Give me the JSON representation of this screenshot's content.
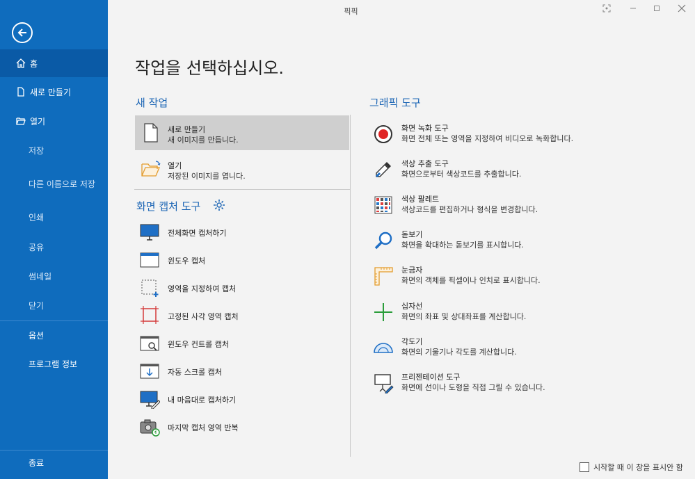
{
  "app": {
    "title": "픽픽"
  },
  "sidebar": {
    "items": [
      {
        "label": "홈"
      },
      {
        "label": "새로 만들기"
      },
      {
        "label": "열기"
      },
      {
        "label": "저장"
      },
      {
        "label": "다른 이름으로 저장"
      },
      {
        "label": "인쇄"
      },
      {
        "label": "공유"
      },
      {
        "label": "썸네일"
      },
      {
        "label": "닫기"
      },
      {
        "label": "옵션"
      },
      {
        "label": "프로그램 정보"
      },
      {
        "label": "종료"
      }
    ]
  },
  "main": {
    "heading": "작업을 선택하십시오.",
    "new_task": {
      "title": "새 작업",
      "items": [
        {
          "title": "새로 만들기",
          "desc": "새 이미지를 만듭니다."
        },
        {
          "title": "열기",
          "desc": "저장된 이미지를 엽니다."
        }
      ]
    },
    "capture": {
      "title": "화면 캡처 도구",
      "items": [
        {
          "label": "전체화면 캡처하기"
        },
        {
          "label": "윈도우 캡처"
        },
        {
          "label": "영역을 지정하여 캡처"
        },
        {
          "label": "고정된 사각 영역 캡처"
        },
        {
          "label": "윈도우 컨트롤 캡처"
        },
        {
          "label": "자동 스크롤 캡처"
        },
        {
          "label": "내 마음대로 캡처하기"
        },
        {
          "label": "마지막 캡처 영역 반복"
        }
      ]
    },
    "graphic": {
      "title": "그래픽 도구",
      "items": [
        {
          "title": "화면 녹화 도구",
          "desc": "화면 전체 또는 영역을 지정하여 비디오로 녹화합니다."
        },
        {
          "title": "색상 추출 도구",
          "desc": "화면으로부터 색상코드를 추출합니다."
        },
        {
          "title": "색상 팔레트",
          "desc": "색상코드를 편집하거나 형식을 변경합니다."
        },
        {
          "title": "돋보기",
          "desc": "화면을 확대하는 돋보기를 표시합니다."
        },
        {
          "title": "눈금자",
          "desc": "화면의 객체를 픽셀이나 인치로 표시합니다."
        },
        {
          "title": "십자선",
          "desc": "화면의 좌표 및 상대좌표를 계산합니다."
        },
        {
          "title": "각도기",
          "desc": "화면의 기울기나 각도를 계산합니다."
        },
        {
          "title": "프리젠테이션 도구",
          "desc": "화면에 선이나 도형을 직접 그릴 수 있습니다."
        }
      ]
    },
    "startup_checkbox": {
      "label": "시작할 때 이 창을 표시안 함",
      "checked": false
    }
  },
  "colors": {
    "sidebar": "#0f6cbd",
    "accent": "#1a64b4",
    "selected": "#cfcfcf"
  }
}
